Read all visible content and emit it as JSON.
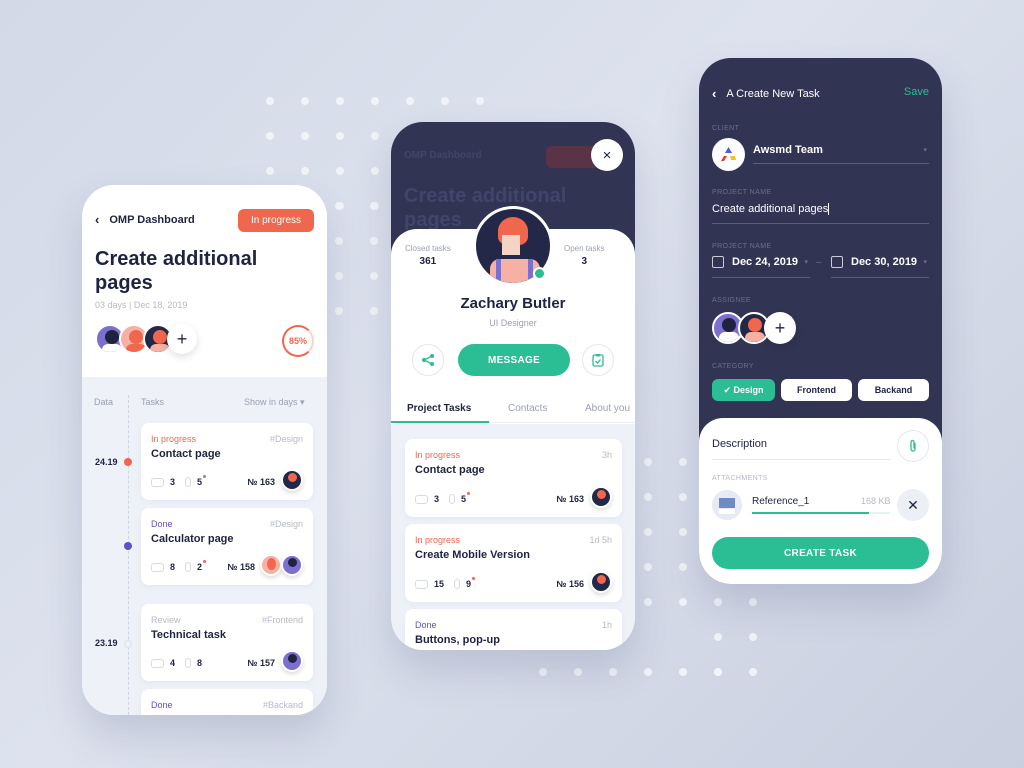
{
  "colors": {
    "accent": "#2bbd93",
    "progress": "#f0674d",
    "done": "#5f52c4",
    "dark": "#323453"
  },
  "dashboard": {
    "back_label": "OMP Dashboard",
    "status_badge": "In progress",
    "title": "Create additional pages",
    "subtitle": "03 days | Dec 18, 2019",
    "progress_percent": 85,
    "progress_label": "85%",
    "add_assignee": "+",
    "columns": {
      "date": "Data",
      "tasks": "Tasks",
      "filter": "Show in days"
    },
    "timeline": [
      {
        "date": "24.19",
        "status": "in-progress"
      },
      {
        "date": "",
        "status": "done"
      },
      {
        "date": "23.19",
        "status": "review"
      }
    ],
    "tasks": [
      {
        "status": "In progress",
        "tag": "#Design",
        "name": "Contact page",
        "comments": "3",
        "attachments": "5",
        "number": "№ 163"
      },
      {
        "status": "Done",
        "tag": "#Design",
        "name": "Calculator page",
        "comments": "8",
        "attachments": "2",
        "number": "№ 158"
      },
      {
        "status": "Review",
        "tag": "#Frontend",
        "name": "Technical task",
        "comments": "4",
        "attachments": "8",
        "number": "№ 157"
      },
      {
        "status": "Done",
        "tag": "#Backand",
        "name": "",
        "comments": "",
        "attachments": "",
        "number": ""
      }
    ]
  },
  "profile": {
    "bg_back_label": "OMP Dashboard",
    "bg_title": "Create additional pages",
    "close_icon": "×",
    "closed_tasks_label": "Closed tasks",
    "closed_tasks": "361",
    "open_tasks_label": "Open tasks",
    "open_tasks": "3",
    "name": "Zachary Butler",
    "role": "UI Designer",
    "message_button": "MESSAGE",
    "tabs": [
      "Project Tasks",
      "Contacts",
      "About you"
    ],
    "tasks": [
      {
        "status": "In progress",
        "time": "3h",
        "name": "Contact page",
        "comments": "3",
        "attachments": "5",
        "number": "№ 163"
      },
      {
        "status": "In progress",
        "time": "1d 5h",
        "name": "Create Mobile Version",
        "comments": "15",
        "attachments": "9",
        "number": "№ 156"
      },
      {
        "status": "Done",
        "time": "1h",
        "name": "Buttons, pop-up",
        "comments": "",
        "attachments": "",
        "number": ""
      }
    ]
  },
  "new_task": {
    "title": "A Create New Task",
    "save": "Save",
    "client_label": "CLIENT",
    "client": "Awsmd Team",
    "project_label": "PROJECT NAME",
    "project_name": "Create additional pages",
    "date_label": "PROJECT NAME",
    "date_start": "Dec 24, 2019",
    "date_end": "Dec 30, 2019",
    "date_sep": "–",
    "assignee_label": "ASSIGNEE",
    "add_assignee": "+",
    "category_label": "CATEGORY",
    "categories": [
      {
        "label": "Design",
        "selected": true
      },
      {
        "label": "Frontend",
        "selected": false
      },
      {
        "label": "Backand",
        "selected": false
      }
    ],
    "description_placeholder": "Description",
    "attachments_label": "ATTACHMENTS",
    "attachment": {
      "name": "Reference_1",
      "size": "168 KB",
      "progress": 0.85
    },
    "create_button": "CREATE TASK"
  }
}
